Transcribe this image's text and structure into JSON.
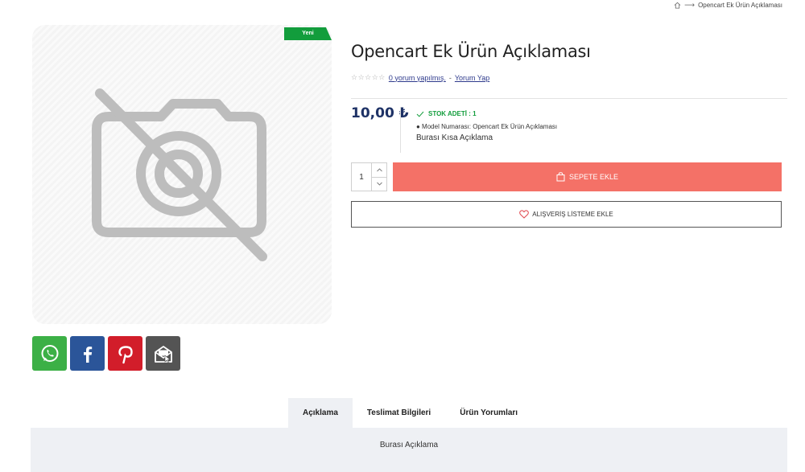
{
  "breadcrumb": {
    "home_icon": "home-icon",
    "separator": "⟶",
    "current": "Opencart Ek Ürün Açıklaması"
  },
  "product": {
    "badge": "Yeni",
    "image_placeholder_icon": "no-camera-icon",
    "title": "Opencart Ek Ürün Açıklaması",
    "stars": "☆☆☆☆☆",
    "reviews_link": "0 yorum yapılmış.",
    "rating_separator": "-",
    "write_review_link": "Yorum Yap",
    "price": "10,00 ₺",
    "stock": "STOK ADETİ : 1",
    "model": "● Model Numarası: Opencart Ek Ürün Açıklaması",
    "short_description": "Burası Kısa Açıklama",
    "quantity": "1",
    "add_to_cart": "SEPETE EKLE",
    "add_to_wishlist": "ALIŞVERİŞ LİSTEME EKLE"
  },
  "social": [
    "whatsapp-icon",
    "facebook-icon",
    "pinterest-icon",
    "mail-icon"
  ],
  "tabs": [
    {
      "label": "Açıklama",
      "active": true
    },
    {
      "label": "Teslimat Bilgileri",
      "active": false
    },
    {
      "label": "Ürün Yorumları",
      "active": false
    }
  ],
  "tab_content": "Burası Açıklama",
  "colors": {
    "accent_cart": "#f47167",
    "badge_green": "#129d3c",
    "price_navy": "#1e3266",
    "whatsapp": "#3cb046",
    "facebook": "#2b5599",
    "pinterest": "#d21d2a",
    "mail": "#545454"
  }
}
